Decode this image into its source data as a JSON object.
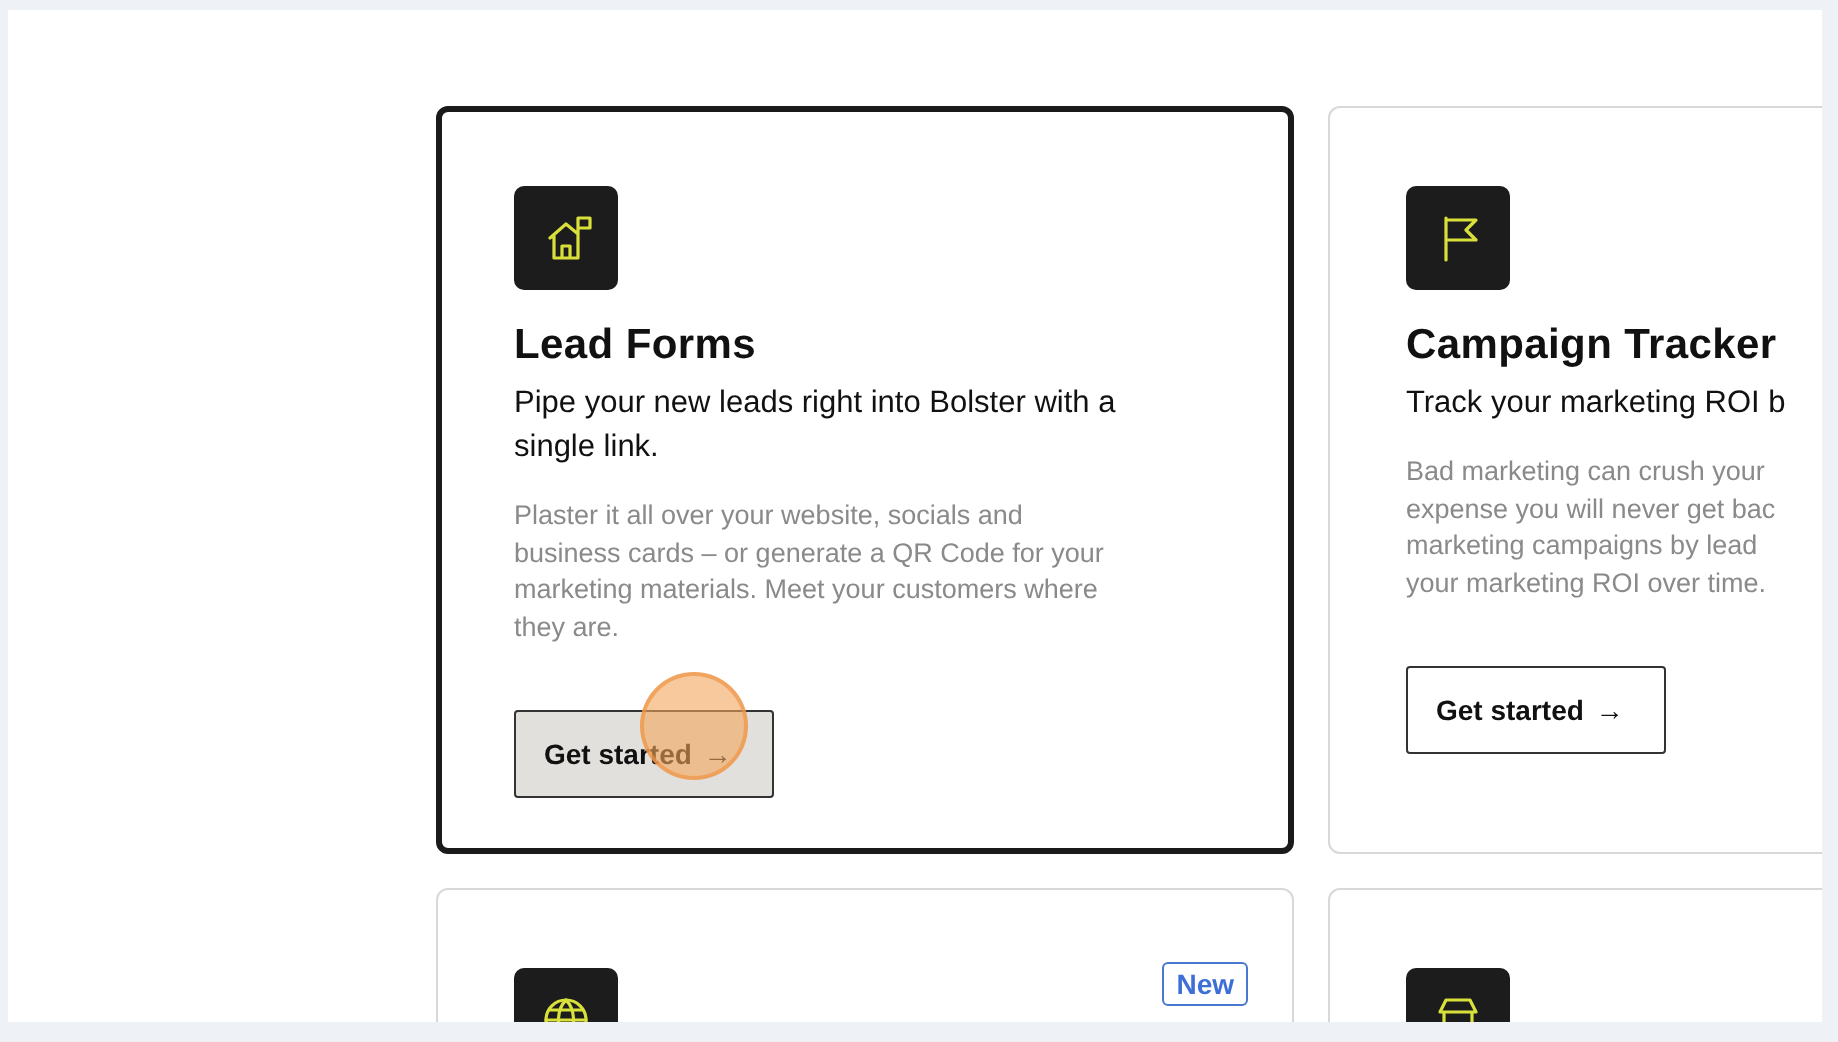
{
  "cards": [
    {
      "kind": "house-flag",
      "title": "Lead Forms",
      "subtitle_lines": [
        "Pipe your new leads right into Bolster with a",
        "single link."
      ],
      "description_lines": [
        "Plaster it all over your website, socials and",
        "business cards – or generate a QR Code for your",
        "marketing materials. Meet your customers where",
        "they are."
      ],
      "button": {
        "label": "Get started",
        "icon": "→",
        "hovered": true
      },
      "selected": true
    },
    {
      "kind": "flag",
      "title": "Campaign Tracker",
      "subtitle_lines": [
        "Track your marketing ROI b"
      ],
      "description_lines": [
        "Bad marketing can crush your",
        "expense you will never get bac",
        "marketing campaigns by lead",
        "your marketing ROI over time."
      ],
      "button": {
        "label": "Get started",
        "icon": "→",
        "hovered": false
      },
      "selected": false
    },
    {
      "kind": "globe",
      "badge": "New",
      "selected": false
    },
    {
      "kind": "store",
      "selected": false
    }
  ]
}
